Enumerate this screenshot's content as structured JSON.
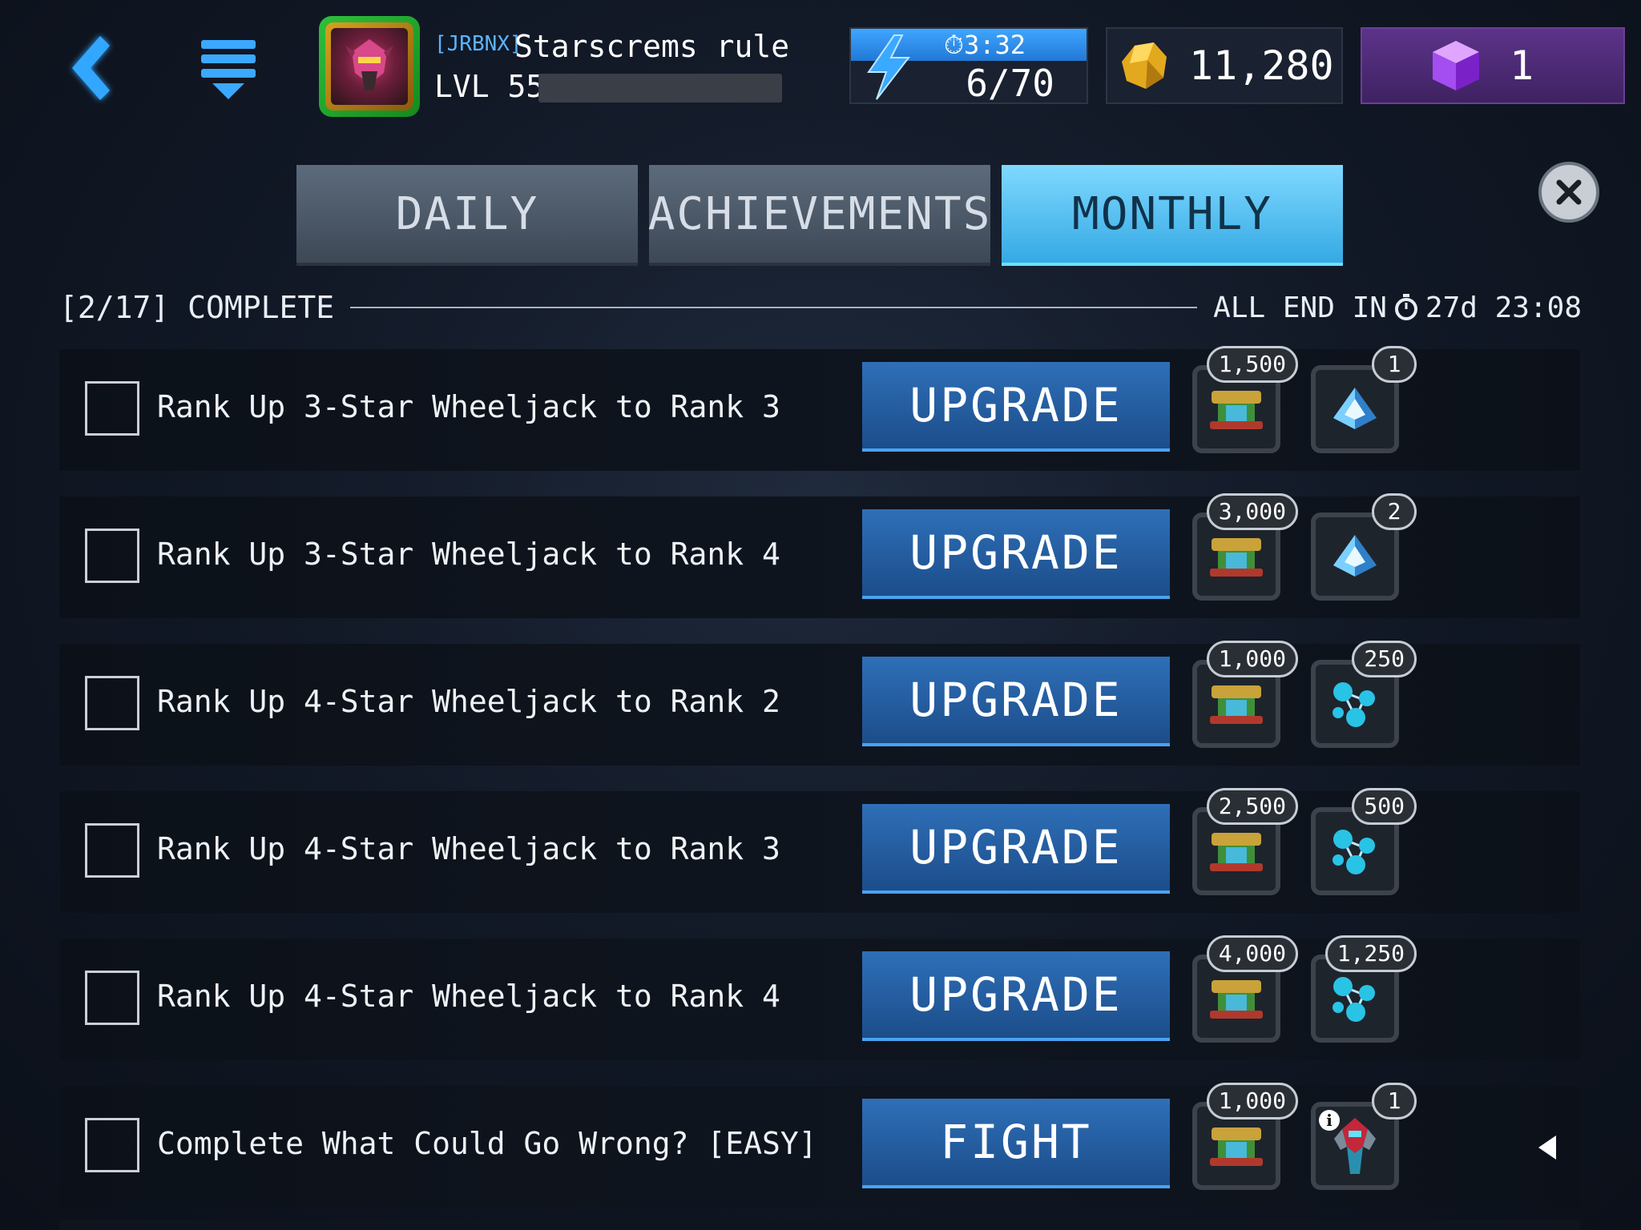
{
  "header": {
    "back_icon": "back-chevron-icon",
    "menu_icon": "menu-stack-icon",
    "player": {
      "tag": "[JRBNX]",
      "name": "Starscrems rule",
      "level_label": "LVL 55",
      "xp_progress": 0
    },
    "energy": {
      "timer": "3:32",
      "count": "6/70"
    },
    "gold": {
      "value": "11,280"
    },
    "gems": {
      "value": "1"
    }
  },
  "tabs": [
    {
      "label": "DAILY",
      "active": false
    },
    {
      "label": "ACHIEVEMENTS",
      "active": false
    },
    {
      "label": "MONTHLY",
      "active": true
    }
  ],
  "status": {
    "complete_label": "[2/17] COMPLETE",
    "end_prefix": "ALL END IN",
    "end_time": "27d 23:08"
  },
  "quests": [
    {
      "label": "Rank Up 3-Star Wheeljack to Rank 3",
      "action": "UPGRADE",
      "reward1": "1,500",
      "reward1_icon": "parts-icon",
      "reward2": "1",
      "reward2_icon": "crystal-icon"
    },
    {
      "label": "Rank Up 3-Star Wheeljack to Rank 4",
      "action": "UPGRADE",
      "reward1": "3,000",
      "reward1_icon": "parts-icon",
      "reward2": "2",
      "reward2_icon": "crystal-icon"
    },
    {
      "label": "Rank Up 4-Star Wheeljack to Rank 2",
      "action": "UPGRADE",
      "reward1": "1,000",
      "reward1_icon": "parts-icon",
      "reward2": "250",
      "reward2_icon": "energon-cluster-icon"
    },
    {
      "label": "Rank Up 4-Star Wheeljack to Rank 3",
      "action": "UPGRADE",
      "reward1": "2,500",
      "reward1_icon": "parts-icon",
      "reward2": "500",
      "reward2_icon": "energon-cluster-icon"
    },
    {
      "label": "Rank Up 4-Star Wheeljack to Rank 4",
      "action": "UPGRADE",
      "reward1": "4,000",
      "reward1_icon": "parts-icon",
      "reward2": "1,250",
      "reward2_icon": "energon-cluster-icon"
    },
    {
      "label": "Complete What Could Go Wrong? [EASY]",
      "action": "FIGHT",
      "reward1": "1,000",
      "reward1_icon": "parts-icon",
      "reward2": "1",
      "reward2_icon": "robot-shard-icon"
    }
  ],
  "colors": {
    "accent_blue": "#35a9e4",
    "button_blue": "#1c4d8a",
    "gem_purple": "#5c3389",
    "avatar_green": "#2fbf3b"
  }
}
